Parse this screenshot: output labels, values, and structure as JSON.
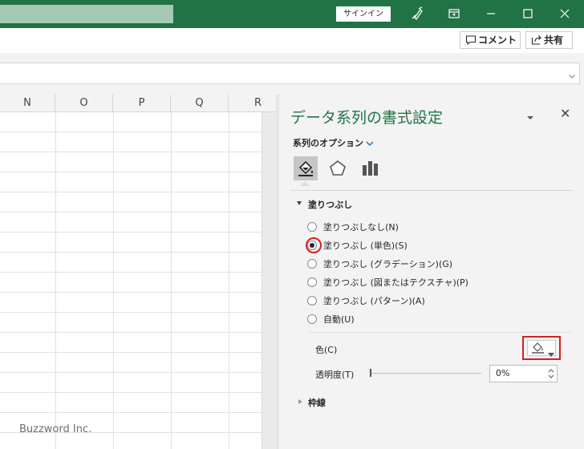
{
  "titlebar": {
    "signin_label": "サインイン",
    "icons": [
      "pen-icon",
      "ribbon-display-icon",
      "minimize-icon",
      "maximize-icon",
      "close-icon"
    ]
  },
  "commands": {
    "comment_label": "コメント",
    "share_label": "共有"
  },
  "sheet": {
    "columns": [
      "N",
      "O",
      "P",
      "Q",
      "R"
    ]
  },
  "watermark": "Buzzword Inc.",
  "pane": {
    "title": "データ系列の書式設定",
    "series_options": "系列のオプション",
    "tabs": [
      "fill-line-icon",
      "effects-icon",
      "series-options-icon"
    ],
    "fill_section": "塗りつぶし",
    "fill_options": [
      {
        "label": "塗りつぶしなし(N)",
        "checked": false
      },
      {
        "label": "塗りつぶし (単色)(S)",
        "checked": true
      },
      {
        "label": "塗りつぶし (グラデーション)(G)",
        "checked": false
      },
      {
        "label": "塗りつぶし (図またはテクスチャ)(P)",
        "checked": false
      },
      {
        "label": "塗りつぶし (パターン)(A)",
        "checked": false
      },
      {
        "label": "自動(U)",
        "checked": false
      }
    ],
    "color_label": "色(C)",
    "transparency_label": "透明度(T)",
    "transparency_value": "0%",
    "border_section": "枠線"
  },
  "colors": {
    "accent": "#217346",
    "highlight": "#d42020"
  }
}
